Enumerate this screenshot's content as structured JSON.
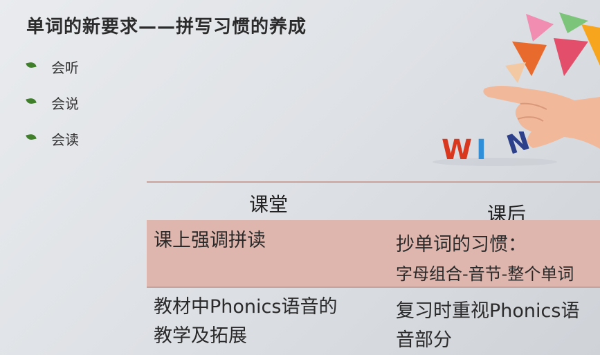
{
  "slide": {
    "title": "单词的新要求——拼写习惯的养成",
    "bullets": [
      "会听",
      "会说",
      "会读"
    ],
    "tiles": [
      "W",
      "I",
      "N"
    ]
  },
  "table": {
    "headers": [
      "课堂",
      "课后"
    ],
    "rows": [
      {
        "col1_lines": [
          "课上强调拼读"
        ],
        "col2_lines": [
          "抄单词的习惯：",
          "字母组合-音节-整个单词"
        ]
      },
      {
        "col1_lines": [
          "教材中Phonics语音的",
          "教学及拓展"
        ],
        "col2_lines": [
          "复习时重视Phonics语",
          "音部分"
        ]
      }
    ]
  },
  "colors": {
    "bullet_leaf": "#3f7f2a",
    "row_highlight": "#dfb6ad",
    "rule": "#c9a19b",
    "tile_w": "#d9381e",
    "tile_i": "#2f8fd8",
    "tile_n": "#2b3f8a"
  }
}
